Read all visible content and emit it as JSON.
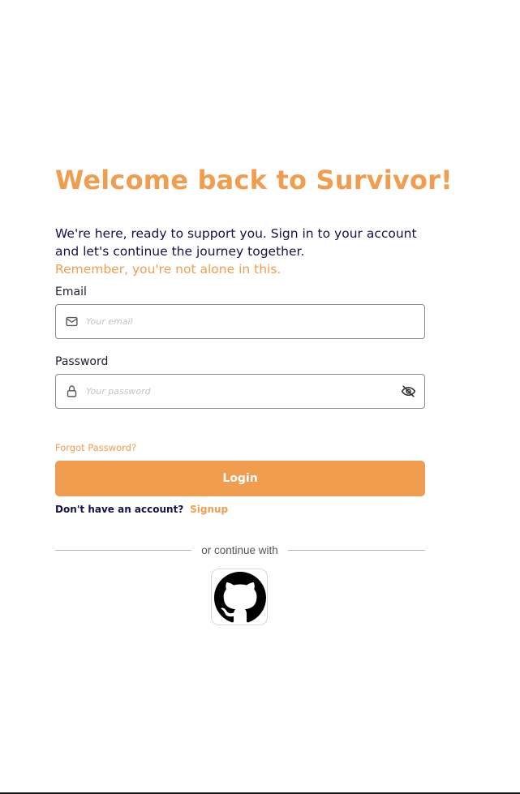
{
  "colors": {
    "accent": "#f19d4f",
    "heading_dark": "#14124a",
    "text_dark": "#1c1c2e"
  },
  "header": {
    "title": "Welcome back to Survivor!",
    "subtitle": "We're here, ready to support you. Sign in to your account and let's continue the journey together.",
    "subtitle_accent": "Remember, you're not alone in this."
  },
  "form": {
    "email": {
      "label": "Email",
      "placeholder": "Your email",
      "value": "",
      "icon": "mail-icon"
    },
    "password": {
      "label": "Password",
      "placeholder": "Your password",
      "value": "",
      "icon": "lock-icon",
      "toggle_icon": "eye-off-icon"
    },
    "forgot_password": "Forgot Password?",
    "login_label": "Login"
  },
  "signup": {
    "prompt": "Don't have an account?",
    "link": "Signup"
  },
  "social": {
    "divider_text": "or continue with",
    "providers": [
      {
        "name": "GitHub",
        "icon": "github-icon"
      }
    ]
  }
}
